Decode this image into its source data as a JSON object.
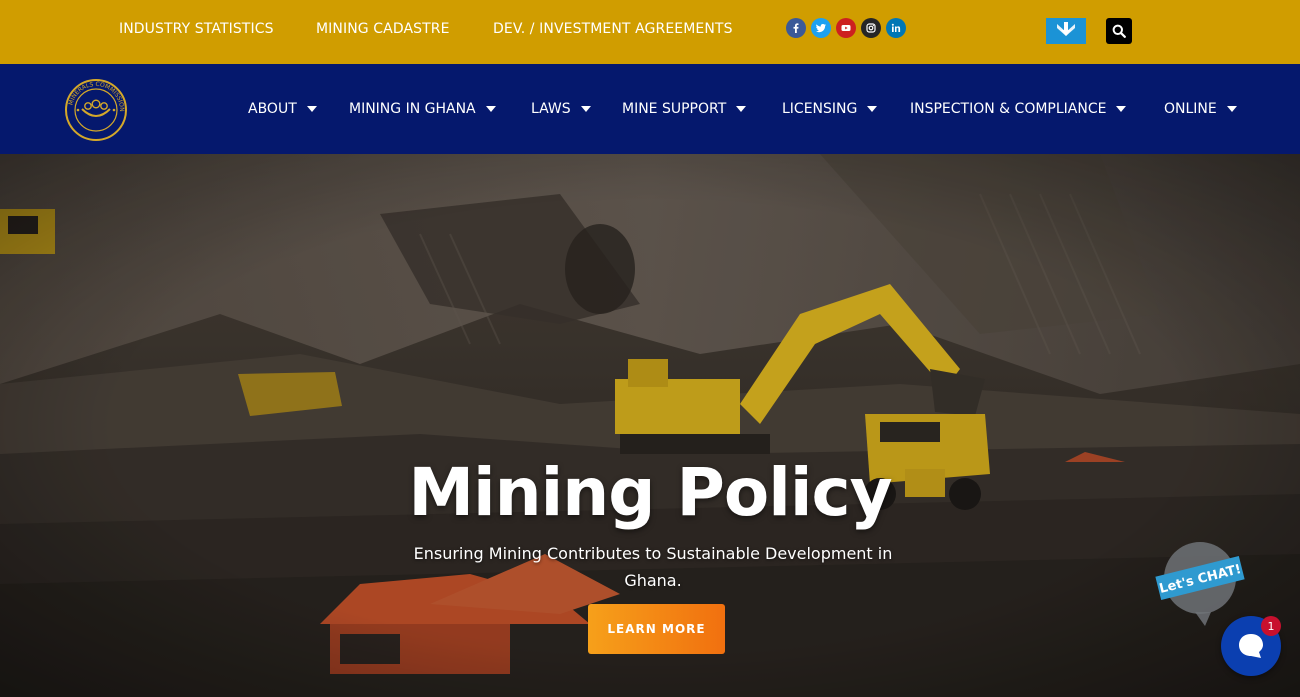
{
  "topbar": {
    "links": [
      "INDUSTRY STATISTICS",
      "MINING CADASTRE",
      "DEV. / INVESTMENT AGREEMENTS"
    ],
    "socials": [
      "facebook-icon",
      "twitter-icon",
      "youtube-icon",
      "instagram-icon",
      "linkedin-icon"
    ],
    "colors": {
      "bar": "#d09d00",
      "facebook": "#3b5998",
      "twitter": "#1da1f2",
      "youtube": "#cd201f",
      "instagram": "#262626",
      "linkedin": "#0077b5"
    }
  },
  "nav": {
    "logo_text": "MINERALS COMMISSION GHANA",
    "items": [
      "ABOUT",
      "MINING IN GHANA",
      "LAWS",
      "MINE SUPPORT",
      "LICENSING",
      "INSPECTION & COMPLIANCE",
      "ONLINE"
    ],
    "color": "#05186d"
  },
  "hero": {
    "title": "Mining Policy",
    "subtitle": "Ensuring Mining Contributes to Sustainable Development in Ghana.",
    "cta": "LEARN MORE"
  },
  "chat": {
    "bubble_text": "Let's CHAT!",
    "badge": "1"
  }
}
